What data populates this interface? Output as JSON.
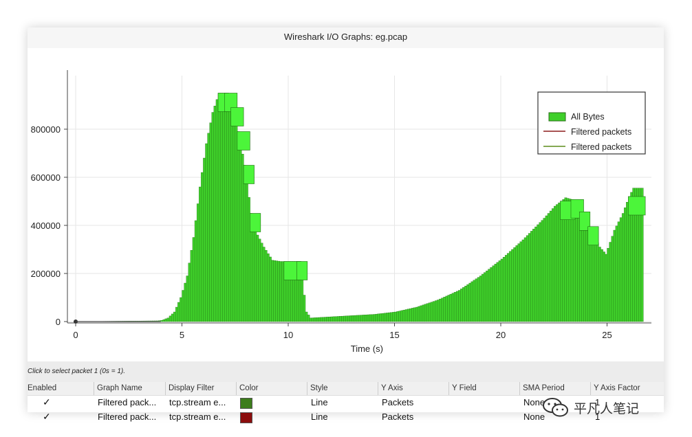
{
  "window": {
    "title": "Wireshark I/O Graphs: eg.pcap"
  },
  "chart_data": {
    "type": "bar",
    "xlabel": "Time (s)",
    "x_ticks": [
      "0",
      "5",
      "10",
      "15",
      "20",
      "25"
    ],
    "y_ticks": [
      "0",
      "200000",
      "400000",
      "600000",
      "800000"
    ],
    "xlim": [
      -0.5,
      27.2
    ],
    "ylim": [
      0,
      960000
    ],
    "grid": true,
    "legend_position": "top-right",
    "series": [
      {
        "name": "All Bytes",
        "color": "#3fcf2a",
        "interval": 0.1,
        "points": [
          [
            0,
            0
          ],
          [
            3.8,
            3000
          ],
          [
            4.0,
            5000
          ],
          [
            4.3,
            15000
          ],
          [
            4.6,
            40000
          ],
          [
            4.9,
            100000
          ],
          [
            5.2,
            190000
          ],
          [
            5.5,
            350000
          ],
          [
            5.8,
            560000
          ],
          [
            6.1,
            740000
          ],
          [
            6.4,
            870000
          ],
          [
            6.7,
            950000
          ],
          [
            7.0,
            950000
          ],
          [
            7.3,
            890000
          ],
          [
            7.6,
            790000
          ],
          [
            7.9,
            650000
          ],
          [
            8.2,
            450000
          ],
          [
            8.5,
            360000
          ],
          [
            8.8,
            310000
          ],
          [
            9.2,
            255000
          ],
          [
            9.6,
            250000
          ],
          [
            10.0,
            250000
          ],
          [
            10.5,
            250000
          ],
          [
            10.8,
            40000
          ],
          [
            11.0,
            15000
          ],
          [
            12.0,
            20000
          ],
          [
            13.0,
            25000
          ],
          [
            14.0,
            30000
          ],
          [
            15.0,
            40000
          ],
          [
            16.0,
            60000
          ],
          [
            17.0,
            90000
          ],
          [
            18.0,
            130000
          ],
          [
            19.0,
            190000
          ],
          [
            20.0,
            260000
          ],
          [
            21.0,
            340000
          ],
          [
            22.0,
            430000
          ],
          [
            22.5,
            480000
          ],
          [
            23.0,
            515000
          ],
          [
            23.4,
            505000
          ],
          [
            23.8,
            440000
          ],
          [
            24.2,
            380000
          ],
          [
            24.6,
            310000
          ],
          [
            24.9,
            280000
          ],
          [
            25.3,
            380000
          ],
          [
            25.7,
            450000
          ],
          [
            26.0,
            520000
          ],
          [
            26.2,
            555000
          ],
          [
            26.6,
            555000
          ]
        ]
      },
      {
        "name": "Filtered packets",
        "color": "#8b1a1a"
      },
      {
        "name": "Filtered packets",
        "color": "#5b8c1a"
      }
    ]
  },
  "status": {
    "text": "Click to select packet 1 (0s = 1)."
  },
  "table": {
    "headers": [
      "Enabled",
      "Graph Name",
      "Display Filter",
      "Color",
      "Style",
      "Y Axis",
      "Y Field",
      "SMA Period",
      "Y Axis Factor"
    ],
    "rows": [
      {
        "enabled": "✓",
        "name": "Filtered pack...",
        "filter": "tcp.stream e...",
        "color": "#3d7d1c",
        "style": "Line",
        "y_axis": "Packets",
        "y_field": "",
        "sma": "None",
        "factor": "1"
      },
      {
        "enabled": "✓",
        "name": "Filtered pack...",
        "filter": "tcp.stream e...",
        "color": "#8b0d0d",
        "style": "Line",
        "y_axis": "Packets",
        "y_field": "",
        "sma": "None",
        "factor": "1"
      }
    ]
  },
  "watermark": {
    "text": "平凡人笔记",
    "icon": "wechat-icon"
  }
}
